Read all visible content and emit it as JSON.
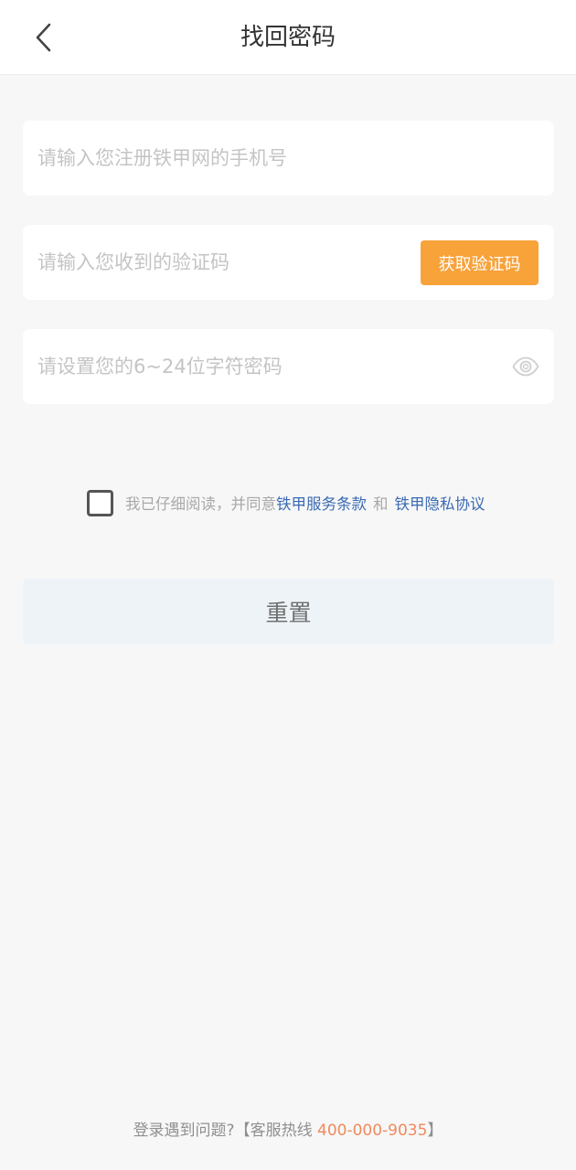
{
  "header": {
    "title": "找回密码",
    "back_icon": "chevron-left-icon"
  },
  "form": {
    "phone_placeholder": "请输入您注册铁甲网的手机号",
    "code_placeholder": "请输入您收到的验证码",
    "get_code_label": "获取验证码",
    "password_placeholder": "请设置您的6~24位字符密码",
    "eye_icon": "eye-icon"
  },
  "agreement": {
    "checked": false,
    "prefix": "我已仔细阅读，并同意",
    "terms_link": "铁甲服务条款",
    "and": "和",
    "privacy_link": "铁甲隐私协议"
  },
  "reset_label": "重置",
  "footer": {
    "prefix": "登录遇到问题?【客服热线 ",
    "hotline": "400-000-9035",
    "suffix": "】"
  },
  "colors": {
    "accent_orange": "#f8a23a",
    "link_blue": "#3a6ab3",
    "hotline_orange": "#f08a5d",
    "background": "#f7f7f7"
  }
}
